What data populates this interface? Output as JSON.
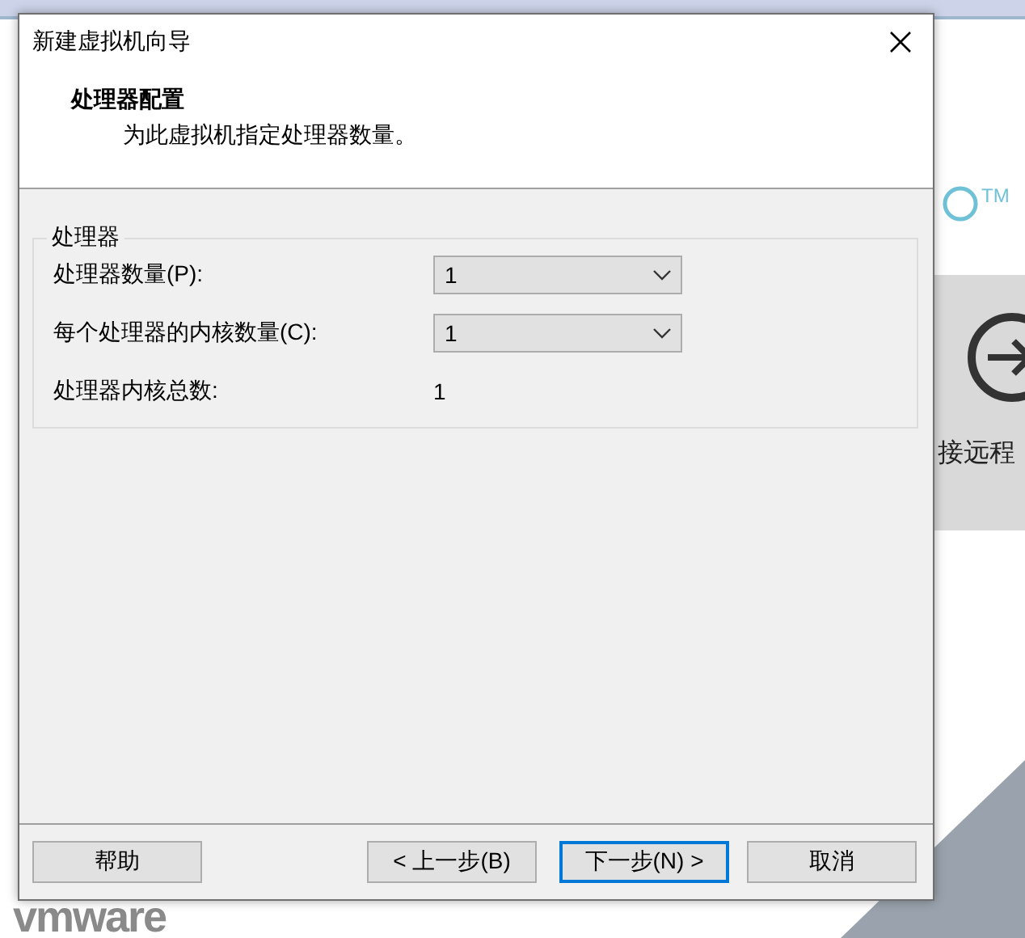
{
  "background_app": {
    "logo_text": "vmware",
    "trademark": "TM",
    "remote_label": "接远程"
  },
  "window": {
    "title": "新建虚拟机向导"
  },
  "header": {
    "title": "处理器配置",
    "subtitle": "为此虚拟机指定处理器数量。"
  },
  "group": {
    "legend": "处理器",
    "fields": [
      {
        "kind": "select",
        "label": "处理器数量(P):",
        "value": "1"
      },
      {
        "kind": "select",
        "label": "每个处理器的内核数量(C):",
        "value": "1"
      },
      {
        "kind": "readout",
        "label": "处理器内核总数:",
        "value": "1"
      }
    ]
  },
  "buttons": [
    {
      "label": "帮助",
      "default": false
    },
    {
      "label": "< 上一步(B)",
      "default": false
    },
    {
      "label": "下一步(N) >",
      "default": true
    },
    {
      "label": "取消",
      "default": false
    }
  ]
}
